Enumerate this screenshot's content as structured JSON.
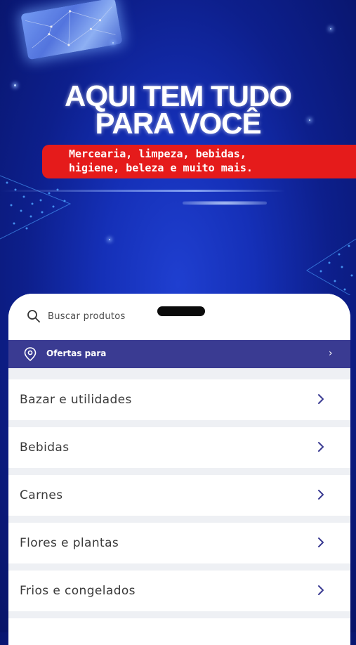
{
  "promo": {
    "headline_line1": "AQUI TEM TUDO",
    "headline_line2": "PARA VOCÊ",
    "banner_line1": "Mercearia, limpeza, bebidas,",
    "banner_line2": "higiene, beleza e muito mais."
  },
  "search": {
    "icon": "search-icon",
    "placeholder": "Buscar produtos"
  },
  "offers": {
    "icon": "location-pin-icon",
    "label": "Ofertas para",
    "chevron": "›"
  },
  "categories": [
    {
      "label": "Bazar e utilidades"
    },
    {
      "label": "Bebidas"
    },
    {
      "label": "Carnes"
    },
    {
      "label": "Flores e plantas"
    },
    {
      "label": "Frios e congelados"
    },
    {
      "label": ""
    }
  ],
  "colors": {
    "background_blue": "#1530b8",
    "banner_red": "#e51b1b",
    "offers_bar": "#3a3b92",
    "chevron": "#3a3b92"
  }
}
